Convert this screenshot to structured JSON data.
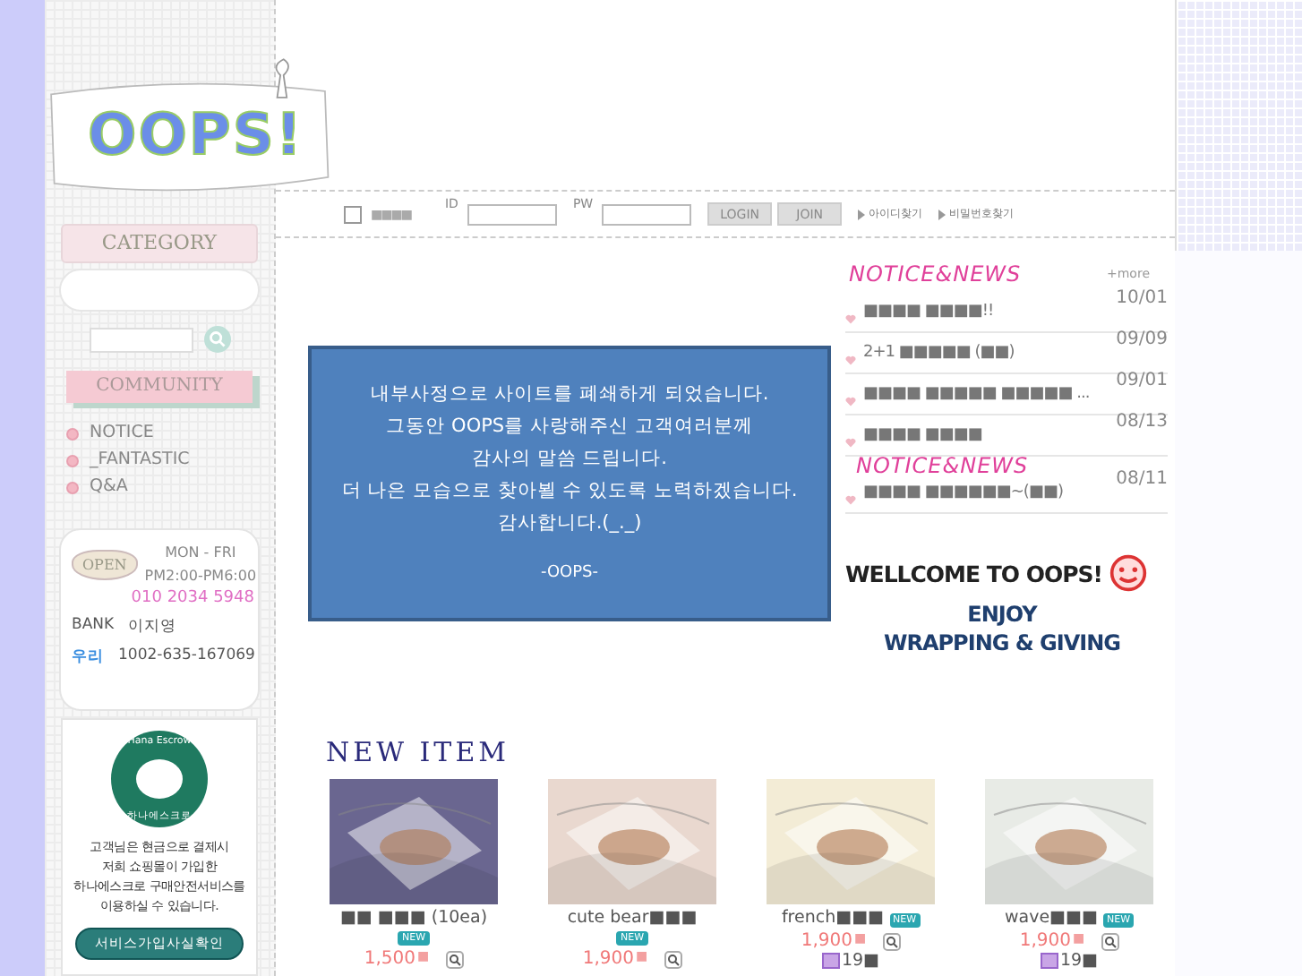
{
  "logo": {
    "text": "OOPS!"
  },
  "login": {
    "remember_label": "■■■■",
    "remember_checked": false,
    "id_label": "ID",
    "pw_label": "PW",
    "buttons": [
      "LOGIN",
      "JOIN"
    ],
    "links": [
      "아이디찾기",
      "비밀번호찾기"
    ]
  },
  "sidebar": {
    "category_title": "CATEGORY",
    "community_title": "COMMUNITY",
    "community_items": [
      "NOTICE",
      "_FANTASTIC",
      "Q&A"
    ],
    "hours": {
      "days": "MON - FRI",
      "time": "PM2:00-PM6:00",
      "phone": "010 2034 5948",
      "sign": "OPEN",
      "bank_label": "BANK",
      "bank_owner": "이지영",
      "bank_name": "우리",
      "account": "1002-635-167069"
    },
    "escrow": {
      "badge_top": "Hana Escrow",
      "badge_bottom": "하나에스크로",
      "text": "고객님은 현금으로 결제시\n저희 쇼핑몰이 가입한\n하나에스크로 구매안전서비스를\n이용하실 수 있습니다.",
      "button": "서비스가입사실확인"
    }
  },
  "notice_popup": {
    "lines": [
      "내부사정으로 사이트를 폐쇄하게 되었습니다.",
      "그동안 OOPS를 사랑해주신 고객여러분께",
      "감사의 말씀 드립니다.",
      "더 나은 모습으로 찾아뵐 수 있도록 노력하겠습니다.",
      "감사합니다.(_._)"
    ],
    "signature": "-OOPS-"
  },
  "news": {
    "title": "NOTICE&NEWS",
    "more": "+more",
    "overlay_title": "NOTICE&NEWS",
    "items": [
      {
        "title": "■■■■ ■■■■!!",
        "date": "10/01"
      },
      {
        "title": "2+1 ■■■■■ (■■)",
        "date": "09/09"
      },
      {
        "title": "■■■■ ■■■■■ ■■■■■ ...",
        "date": "09/01"
      },
      {
        "title": "■■■■ ■■■■",
        "date": "08/13"
      },
      {
        "title": "■■■■ ■■■■■■~(■■)",
        "date": "08/11"
      }
    ]
  },
  "welcome": {
    "title": "WELLCOME TO OOPS!",
    "line1": "ENJOY",
    "line2": "WRAPPING & GIVING"
  },
  "new_items": {
    "title": "NEW ITEM",
    "items": [
      {
        "kind": "stacked",
        "name": "■■ ■■■ (10ea)",
        "badge": "NEW",
        "price": "1,500",
        "unit": "■"
      },
      {
        "kind": "stacked",
        "name": "cute bear■■■",
        "badge": "NEW",
        "price": "1,900",
        "unit": "■"
      },
      {
        "kind": "inline",
        "name": "french■■■",
        "badge": "NEW",
        "price": "1,900",
        "unit": "■",
        "points": "19■"
      },
      {
        "kind": "inline",
        "name": "wave■■■",
        "badge": "NEW",
        "price": "1,900",
        "unit": "■",
        "points": "19■"
      }
    ]
  }
}
